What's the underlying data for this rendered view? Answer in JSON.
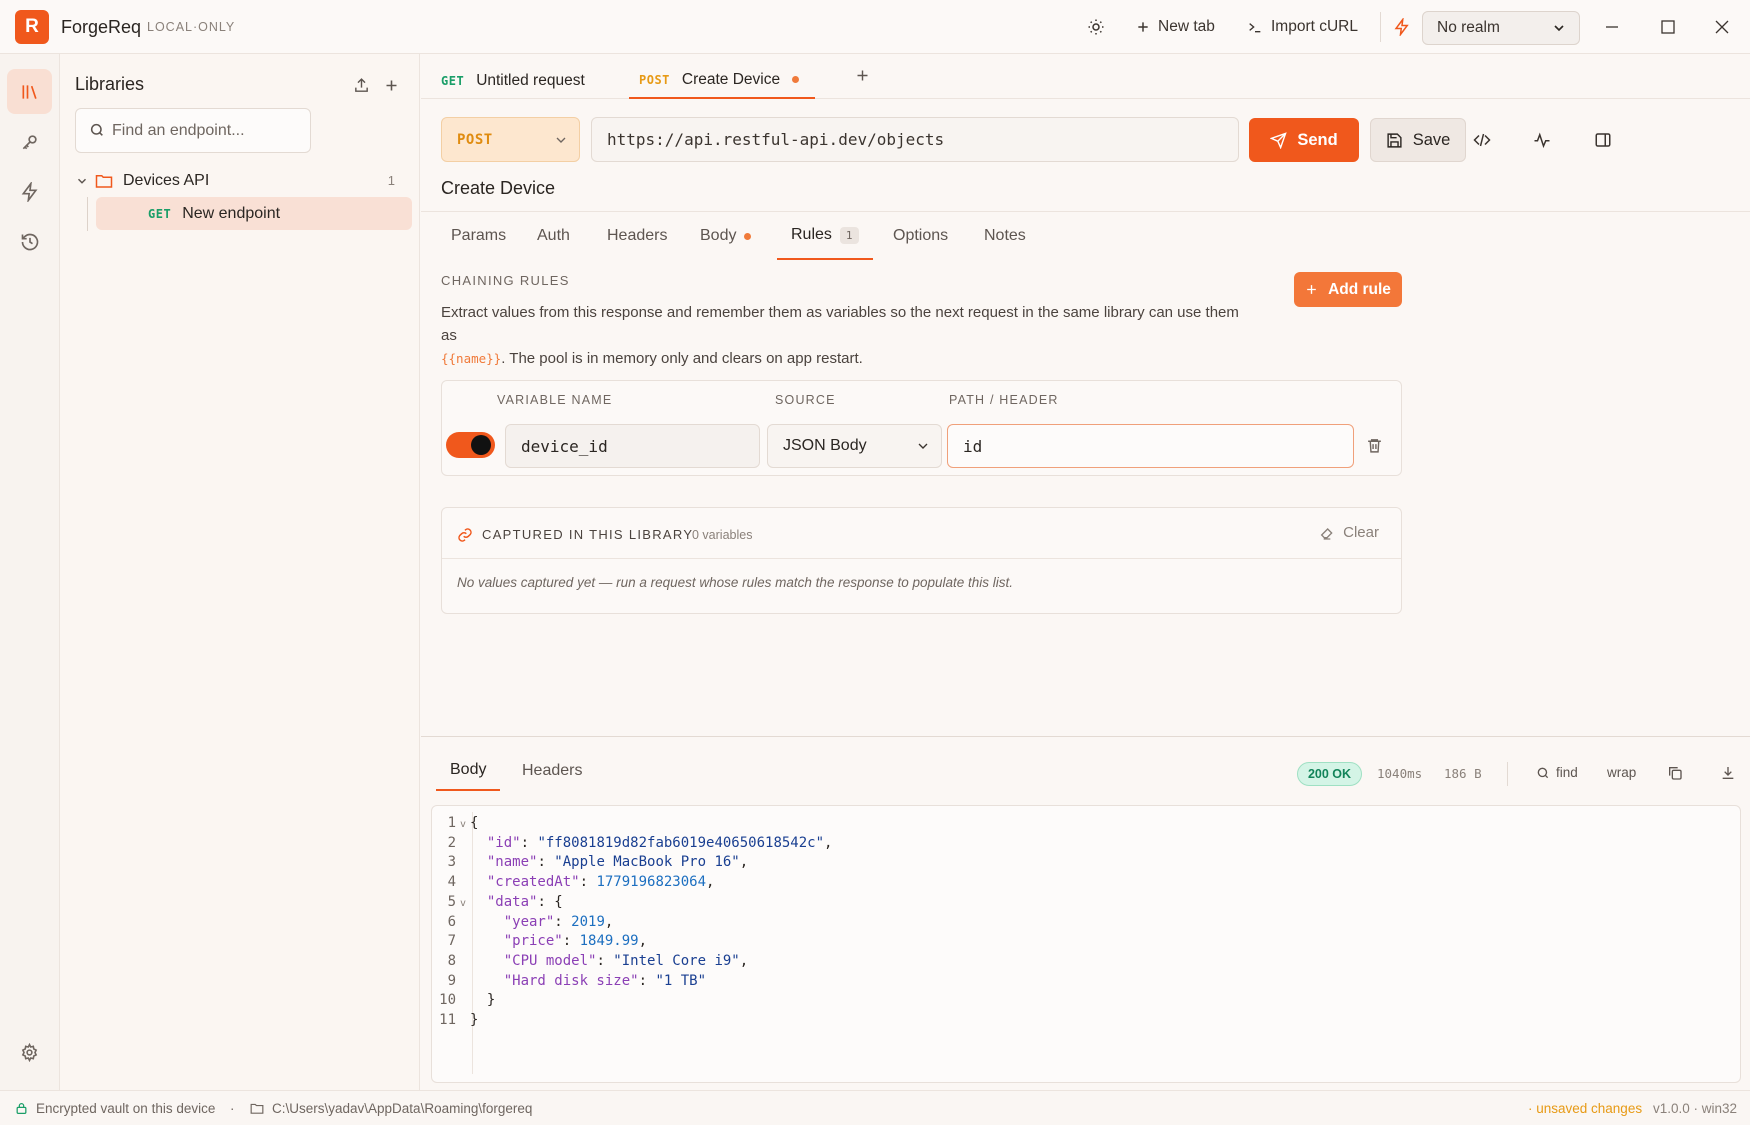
{
  "app": {
    "logo_letter": "R",
    "name": "ForgeReq",
    "mode": "LOCAL·ONLY"
  },
  "titlebar": {
    "new_tab_label": "New tab",
    "import_curl_label": "Import cURL",
    "realm_selected": "No realm"
  },
  "sidebar": {
    "title": "Libraries",
    "search_placeholder": "Find an endpoint...",
    "folder": {
      "name": "Devices API",
      "count": "1"
    },
    "item": {
      "method": "GET",
      "name": "New endpoint"
    }
  },
  "tabs": [
    {
      "method": "GET",
      "label": "Untitled request"
    },
    {
      "method": "POST",
      "label": "Create Device"
    }
  ],
  "request": {
    "method": "POST",
    "url": "https://api.restful-api.dev/objects",
    "send_label": "Send",
    "save_label": "Save",
    "name": "Create Device"
  },
  "sub_tabs": {
    "params": "Params",
    "auth": "Auth",
    "headers": "Headers",
    "body": "Body",
    "rules": "Rules",
    "rules_count": "1",
    "options": "Options",
    "notes": "Notes"
  },
  "chaining": {
    "section_label": "CHAINING RULES",
    "desc_line1": "Extract values from this response and remember them as variables so the next request in the same library can use them as",
    "desc_template": "{{name}}",
    "desc_line2": ". The pool is in memory only and clears on app restart.",
    "add_rule_label": "Add rule",
    "headers": {
      "variable": "VARIABLE NAME",
      "source": "SOURCE",
      "path": "PATH / HEADER"
    },
    "rule": {
      "enabled": true,
      "variable": "device_id",
      "source": "JSON Body",
      "path": "id"
    }
  },
  "captured": {
    "title": "CAPTURED IN THIS LIBRARY",
    "count": "0 variables",
    "clear_label": "Clear",
    "empty_text": "No values captured yet — run a request whose rules match the response to populate this list."
  },
  "response": {
    "tab_body": "Body",
    "tab_headers": "Headers",
    "status": "200 OK",
    "time": "1040ms",
    "size": "186 B",
    "find_label": "find",
    "wrap_label": "wrap",
    "lines": [
      {
        "n": "1",
        "fold": "v",
        "indent": "",
        "tokens": [
          [
            "p",
            "{"
          ]
        ]
      },
      {
        "n": "2",
        "fold": "",
        "indent": "  ",
        "tokens": [
          [
            "k",
            "\"id\""
          ],
          [
            "p",
            ": "
          ],
          [
            "s",
            "\"ff8081819d82fab6019e40650618542c\""
          ],
          [
            "p",
            ","
          ]
        ]
      },
      {
        "n": "3",
        "fold": "",
        "indent": "  ",
        "tokens": [
          [
            "k",
            "\"name\""
          ],
          [
            "p",
            ": "
          ],
          [
            "s",
            "\"Apple MacBook Pro 16\""
          ],
          [
            "p",
            ","
          ]
        ]
      },
      {
        "n": "4",
        "fold": "",
        "indent": "  ",
        "tokens": [
          [
            "k",
            "\"createdAt\""
          ],
          [
            "p",
            ": "
          ],
          [
            "n",
            "1779196823064"
          ],
          [
            "p",
            ","
          ]
        ]
      },
      {
        "n": "5",
        "fold": "v",
        "indent": "  ",
        "tokens": [
          [
            "k",
            "\"data\""
          ],
          [
            "p",
            ": {"
          ]
        ]
      },
      {
        "n": "6",
        "fold": "",
        "indent": "    ",
        "tokens": [
          [
            "k",
            "\"year\""
          ],
          [
            "p",
            ": "
          ],
          [
            "n",
            "2019"
          ],
          [
            "p",
            ","
          ]
        ]
      },
      {
        "n": "7",
        "fold": "",
        "indent": "    ",
        "tokens": [
          [
            "k",
            "\"price\""
          ],
          [
            "p",
            ": "
          ],
          [
            "n",
            "1849.99"
          ],
          [
            "p",
            ","
          ]
        ]
      },
      {
        "n": "8",
        "fold": "",
        "indent": "    ",
        "tokens": [
          [
            "k",
            "\"CPU model\""
          ],
          [
            "p",
            ": "
          ],
          [
            "s",
            "\"Intel Core i9\""
          ],
          [
            "p",
            ","
          ]
        ]
      },
      {
        "n": "9",
        "fold": "",
        "indent": "    ",
        "tokens": [
          [
            "k",
            "\"Hard disk size\""
          ],
          [
            "p",
            ": "
          ],
          [
            "s",
            "\"1 TB\""
          ]
        ]
      },
      {
        "n": "10",
        "fold": "",
        "indent": "  ",
        "tokens": [
          [
            "p",
            "}"
          ]
        ]
      },
      {
        "n": "11",
        "fold": "",
        "indent": "",
        "tokens": [
          [
            "p",
            "}"
          ]
        ]
      }
    ]
  },
  "statusbar": {
    "vault": "Encrypted vault on this device",
    "separator": "·",
    "path": "C:\\Users\\yadav\\AppData\\Roaming\\forgereq",
    "unsaved": "· unsaved changes",
    "version": "v1.0.0 · win32"
  },
  "colors": {
    "accent": "#f0581c",
    "get": "#1a9e68",
    "post": "#e79a15",
    "status_ok": "#13845a"
  }
}
